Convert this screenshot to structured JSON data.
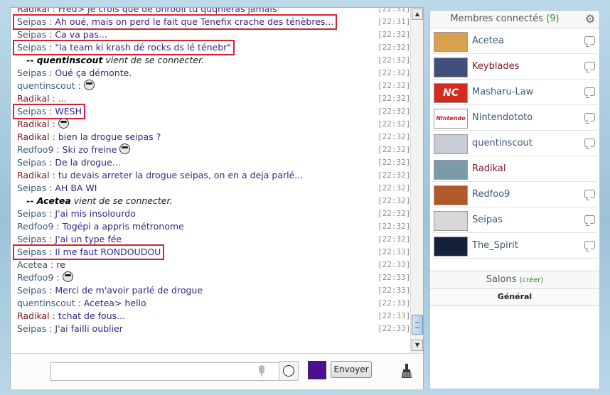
{
  "chat": {
    "messages": [
      {
        "type": "msg",
        "user": "Radikal",
        "text": "Fred> Je crois que de ohrooli tu quqnieras jamais",
        "time": "[22:31]",
        "highlight": false
      },
      {
        "type": "msg",
        "user": "Seipas",
        "text": "Ah oué, mais on perd le fait que Tenefix crache des ténèbres...",
        "time": "[22:31]",
        "highlight": true
      },
      {
        "type": "msg",
        "user": "Seipas",
        "text": "Ca va pas...",
        "time": "[22:32]",
        "highlight": false
      },
      {
        "type": "msg",
        "user": "Seipas",
        "text": "\"la team ki krash dé rocks ds lé ténebr\"",
        "time": "[22:32]",
        "highlight": true
      },
      {
        "type": "system",
        "user": "quentinscout",
        "text": "vient de se connecter.",
        "time": "[22:32]"
      },
      {
        "type": "msg",
        "user": "Seipas",
        "text": "Oué ça démonte.",
        "time": "[22:32]",
        "highlight": false
      },
      {
        "type": "msg",
        "user": "quentinscout",
        "text": "",
        "time": "[22:32]",
        "highlight": false,
        "smiley": true
      },
      {
        "type": "msg",
        "user": "Radikal",
        "text": "...",
        "time": "[22:32]",
        "highlight": false
      },
      {
        "type": "msg",
        "user": "Seipas",
        "text": "WESH",
        "time": "[22:32]",
        "highlight": true
      },
      {
        "type": "msg",
        "user": "Radikal",
        "text": "",
        "time": "[22:32]",
        "highlight": false,
        "smiley": true
      },
      {
        "type": "msg",
        "user": "Radikal",
        "text": "bien la drogue seipas ?",
        "time": "[22:32]",
        "highlight": false
      },
      {
        "type": "msg",
        "user": "Redfoo9",
        "text": "Ski zo freine",
        "time": "[22:32]",
        "highlight": false,
        "smiley": true
      },
      {
        "type": "msg",
        "user": "Seipas",
        "text": "De la drogue...",
        "time": "[22:32]",
        "highlight": false
      },
      {
        "type": "msg",
        "user": "Radikal",
        "text": "tu devais arreter la drogue seipas, on en a deja parlé...",
        "time": "[22:32]",
        "highlight": false
      },
      {
        "type": "msg",
        "user": "Seipas",
        "text": "AH BA WI",
        "time": "[22:32]",
        "highlight": false
      },
      {
        "type": "system",
        "user": "Acetea",
        "text": "vient de se connecter.",
        "time": "[22:32]"
      },
      {
        "type": "msg",
        "user": "Seipas",
        "text": "J'ai mis insolourdo",
        "time": "[22:32]",
        "highlight": false
      },
      {
        "type": "msg",
        "user": "Redfoo9",
        "text": "Togépi a appris métronome",
        "time": "[22:32]",
        "highlight": false
      },
      {
        "type": "msg",
        "user": "Seipas",
        "text": "J'ai un type fée",
        "time": "[22:32]",
        "highlight": false
      },
      {
        "type": "msg",
        "user": "Seipas",
        "text": "Il me faut RONDOUDOU",
        "time": "[22:33]",
        "highlight": true
      },
      {
        "type": "msg",
        "user": "Acetea",
        "text": "re",
        "time": "[22:33]",
        "highlight": false
      },
      {
        "type": "msg",
        "user": "Redfoo9",
        "text": "",
        "time": "[22:33]",
        "highlight": false,
        "smiley": true
      },
      {
        "type": "msg",
        "user": "Seipas",
        "text": "Merci de m'avoir parlé de drogue",
        "time": "[22:33]",
        "highlight": false
      },
      {
        "type": "msg",
        "user": "quentinscout",
        "text": "Acetea> hello",
        "time": "[22:33]",
        "highlight": false
      },
      {
        "type": "msg",
        "user": "Radikal",
        "text": "tchat de fous...",
        "time": "[22:33]",
        "highlight": false
      },
      {
        "type": "msg",
        "user": "Seipas",
        "text": "J'ai failli oublier",
        "time": "[22:33]",
        "highlight": false
      }
    ],
    "separator": " : ",
    "system_prefix": "-- "
  },
  "input": {
    "value": "",
    "send_label": "Envoyer",
    "text_color": "#4b0f93"
  },
  "members": {
    "title": "Membres connectés",
    "count": "(9)",
    "list": [
      {
        "name": "Acetea",
        "avatar_color": "#d9a050",
        "pm": true,
        "admin": false
      },
      {
        "name": "Keyblades",
        "avatar_color": "#3d4f7a",
        "pm": true,
        "admin": true
      },
      {
        "name": "Masharu-Law",
        "avatar_color": "#d42a1f",
        "pm": true,
        "admin": false,
        "avatar_text": "NC"
      },
      {
        "name": "Nintendototo",
        "avatar_color": "#ffffff",
        "pm": true,
        "admin": false,
        "avatar_text": "Nintendo"
      },
      {
        "name": "quentinscout",
        "avatar_color": "#c8ccd4",
        "pm": true,
        "admin": false
      },
      {
        "name": "Radikal",
        "avatar_color": "#7c9aa8",
        "pm": false,
        "admin": true
      },
      {
        "name": "Redfoo9",
        "avatar_color": "#b05a2c",
        "pm": true,
        "admin": false
      },
      {
        "name": "Seipas",
        "avatar_color": "#d8d8d8",
        "pm": true,
        "admin": false
      },
      {
        "name": "The_Spirit",
        "avatar_color": "#15203a",
        "pm": true,
        "admin": false
      }
    ]
  },
  "salons": {
    "title": "Salons",
    "create": "(créer)",
    "rooms": [
      "Général"
    ]
  }
}
